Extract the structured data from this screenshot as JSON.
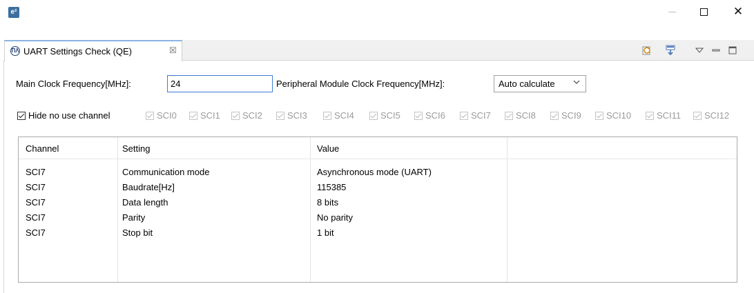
{
  "window": {
    "app_icon_text": "e²",
    "controls": {
      "minimize": "—",
      "close": "✕"
    }
  },
  "view_tab": {
    "label": "UART Settings Check (QE)",
    "close_glyph": "☒",
    "icon": "qe-view-icon"
  },
  "view_toolbar": [
    "sync-icon",
    "export-icon",
    "view-menu-icon",
    "minimize-view-icon",
    "maximize-view-icon"
  ],
  "form": {
    "main_clock_label": "Main Clock Frequency[MHz]:",
    "main_clock_value": "24",
    "peripheral_clock_label": "Peripheral Module Clock Frequency[MHz]:",
    "peripheral_clock_selected": "Auto calculate"
  },
  "checkboxes": {
    "hide_unused": {
      "label": "Hide no use channel",
      "checked": true
    },
    "channels": [
      {
        "label": "SCI0",
        "checked": true,
        "enabled": false
      },
      {
        "label": "SCI1",
        "checked": true,
        "enabled": false
      },
      {
        "label": "SCI2",
        "checked": true,
        "enabled": false
      },
      {
        "label": "SCI3",
        "checked": true,
        "enabled": false
      },
      {
        "label": "SCI4",
        "checked": true,
        "enabled": false
      },
      {
        "label": "SCI5",
        "checked": true,
        "enabled": false
      },
      {
        "label": "SCI6",
        "checked": true,
        "enabled": false
      },
      {
        "label": "SCI7",
        "checked": true,
        "enabled": false
      },
      {
        "label": "SCI8",
        "checked": true,
        "enabled": false
      },
      {
        "label": "SCI9",
        "checked": true,
        "enabled": false
      },
      {
        "label": "SCI10",
        "checked": true,
        "enabled": false
      },
      {
        "label": "SCI11",
        "checked": true,
        "enabled": false
      },
      {
        "label": "SCI12",
        "checked": true,
        "enabled": false
      }
    ]
  },
  "table": {
    "headers": [
      "Channel",
      "Setting",
      "Value"
    ],
    "rows": [
      [
        "SCI7",
        "Communication mode",
        "Asynchronous mode (UART)"
      ],
      [
        "SCI7",
        "Baudrate[Hz]",
        "115385"
      ],
      [
        "SCI7",
        "Data length",
        "8 bits"
      ],
      [
        "SCI7",
        "Parity",
        "No parity"
      ],
      [
        "SCI7",
        "Stop bit",
        "1 bit"
      ]
    ]
  },
  "colors": {
    "input_focus_border": "#3d7bd4",
    "tab_highlight": "#8ab4e0",
    "disabled_text": "#9a9a9a"
  }
}
